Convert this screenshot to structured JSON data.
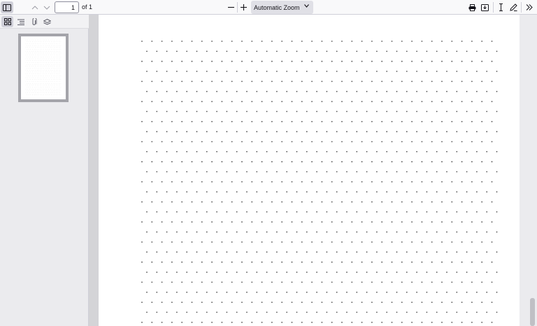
{
  "toolbar": {
    "page_number": "1",
    "page_total": "of 1",
    "zoom_label": "Automatic Zoom",
    "icons": {
      "sidebar_toggle": "sidebar-toggle-icon",
      "prev_page": "chevron-up-icon",
      "next_page": "chevron-down-icon",
      "zoom_out": "minus-icon",
      "zoom_in": "plus-icon",
      "print": "printer-icon",
      "save": "save-icon",
      "text_tool": "text-cursor-icon",
      "draw": "pen-icon",
      "tools": "double-chevron-right-icon"
    }
  },
  "sidebar": {
    "views": [
      "thumbnails-icon",
      "outline-icon",
      "attachments-icon",
      "layers-icon"
    ],
    "active_view": "thumbnails-icon"
  },
  "document": {
    "content": "dot-grid",
    "colors": {
      "dot": "#555555",
      "page": "#ffffff",
      "viewer_bg": "#d4d4d7"
    }
  }
}
